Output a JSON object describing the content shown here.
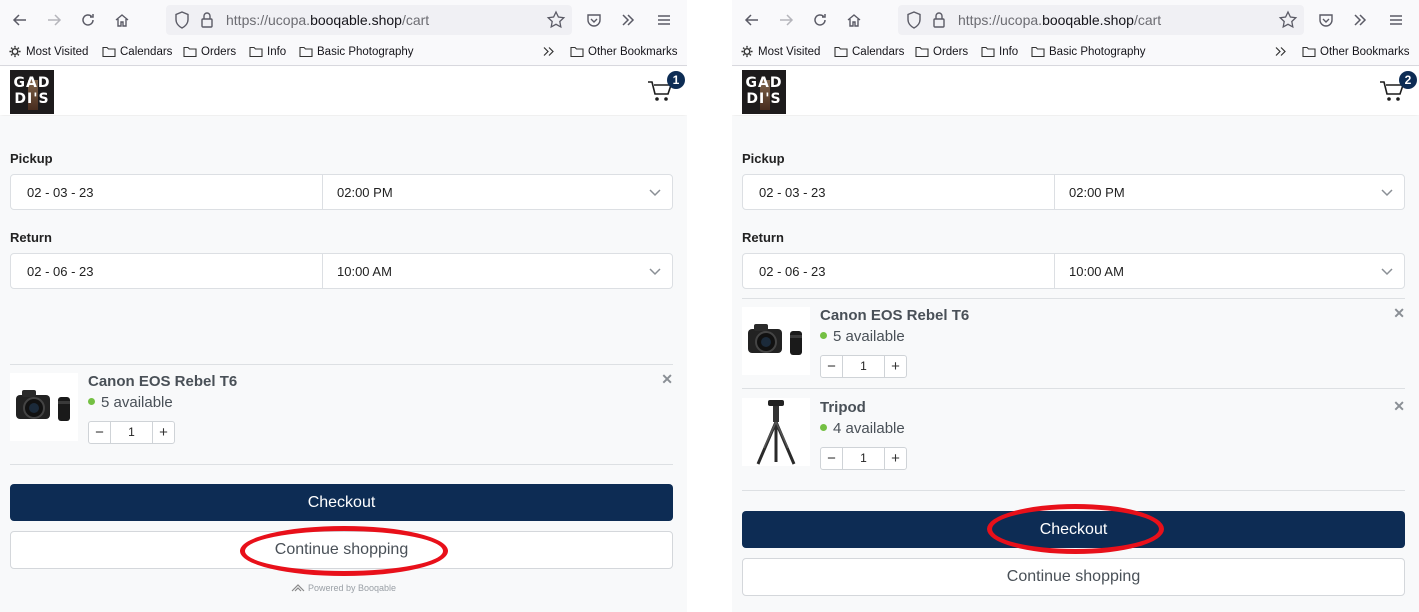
{
  "browser": {
    "url_prefix": "https://ucopa.",
    "url_domain": "booqable.shop",
    "url_path": "/cart",
    "bookmarks": [
      "Most Visited",
      "Calendars",
      "Orders",
      "Info",
      "Basic Photography"
    ],
    "other_bookmarks": "Other Bookmarks"
  },
  "shop": {
    "logo_line1": "GAD",
    "logo_line2": "DI'S",
    "powered_by": "Powered by Booqable"
  },
  "form": {
    "pickup_label": "Pickup",
    "pickup_date": "02 - 03 - 23",
    "pickup_time": "02:00 PM",
    "return_label": "Return",
    "return_date": "02 - 06 - 23",
    "return_time": "10:00 AM"
  },
  "buttons": {
    "checkout": "Checkout",
    "continue": "Continue shopping"
  },
  "panels": [
    {
      "cart_count": "1",
      "highlighted": "continue",
      "items": [
        {
          "name": "Canon EOS Rebel T6",
          "availability": "5 available",
          "quantity": "1"
        }
      ]
    },
    {
      "cart_count": "2",
      "highlighted": "checkout",
      "items": [
        {
          "name": "Canon EOS Rebel T6",
          "availability": "5 available",
          "quantity": "1"
        },
        {
          "name": "Tripod",
          "availability": "4 available",
          "quantity": "1"
        }
      ]
    }
  ],
  "colors": {
    "primary": "#0d2c54",
    "available_dot": "#74c043",
    "annotation": "#e8101a"
  }
}
